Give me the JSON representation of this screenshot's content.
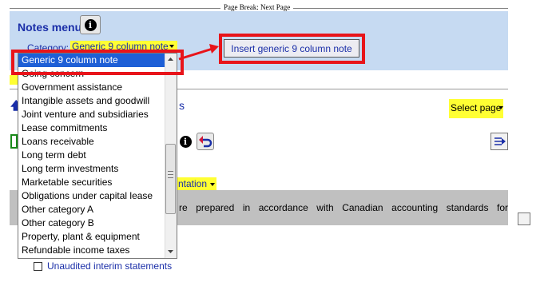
{
  "page_break": {
    "label": "Page Break: Next Page"
  },
  "notes_menu": {
    "title": "Notes menu",
    "info_icon": "info-icon",
    "category_label": "Category:",
    "category_value": "Generic 9 column note",
    "insert_button": "Insert generic 9 column note"
  },
  "dropdown": {
    "items": [
      "Generic 9 column note",
      "Going concern",
      "Government assistance",
      "Intangible assets and goodwill",
      "Joint venture and subsidiaries",
      "Lease commitments",
      "Loans receivable",
      "Long term debt",
      "Long term investments",
      "Marketable securities",
      "Obligations under capital lease",
      "Other category A",
      "Other category B",
      "Property, plant & equipment",
      "Refundable income taxes"
    ],
    "selected_index": 0
  },
  "background": {
    "heading_fragment": "s",
    "select_page": "Select page",
    "presentation_fragment": "ntation",
    "grey_text": "re prepared in accordance with Canadian accounting standards for",
    "unaudited_label": "Unaudited interim statements"
  },
  "colors": {
    "panel_blue": "#c6daf2",
    "highlight_yellow": "#ffff33",
    "selection_blue": "#1e5fd6",
    "annotation_red": "#e8141a",
    "link_blue": "#1a2ea8"
  }
}
